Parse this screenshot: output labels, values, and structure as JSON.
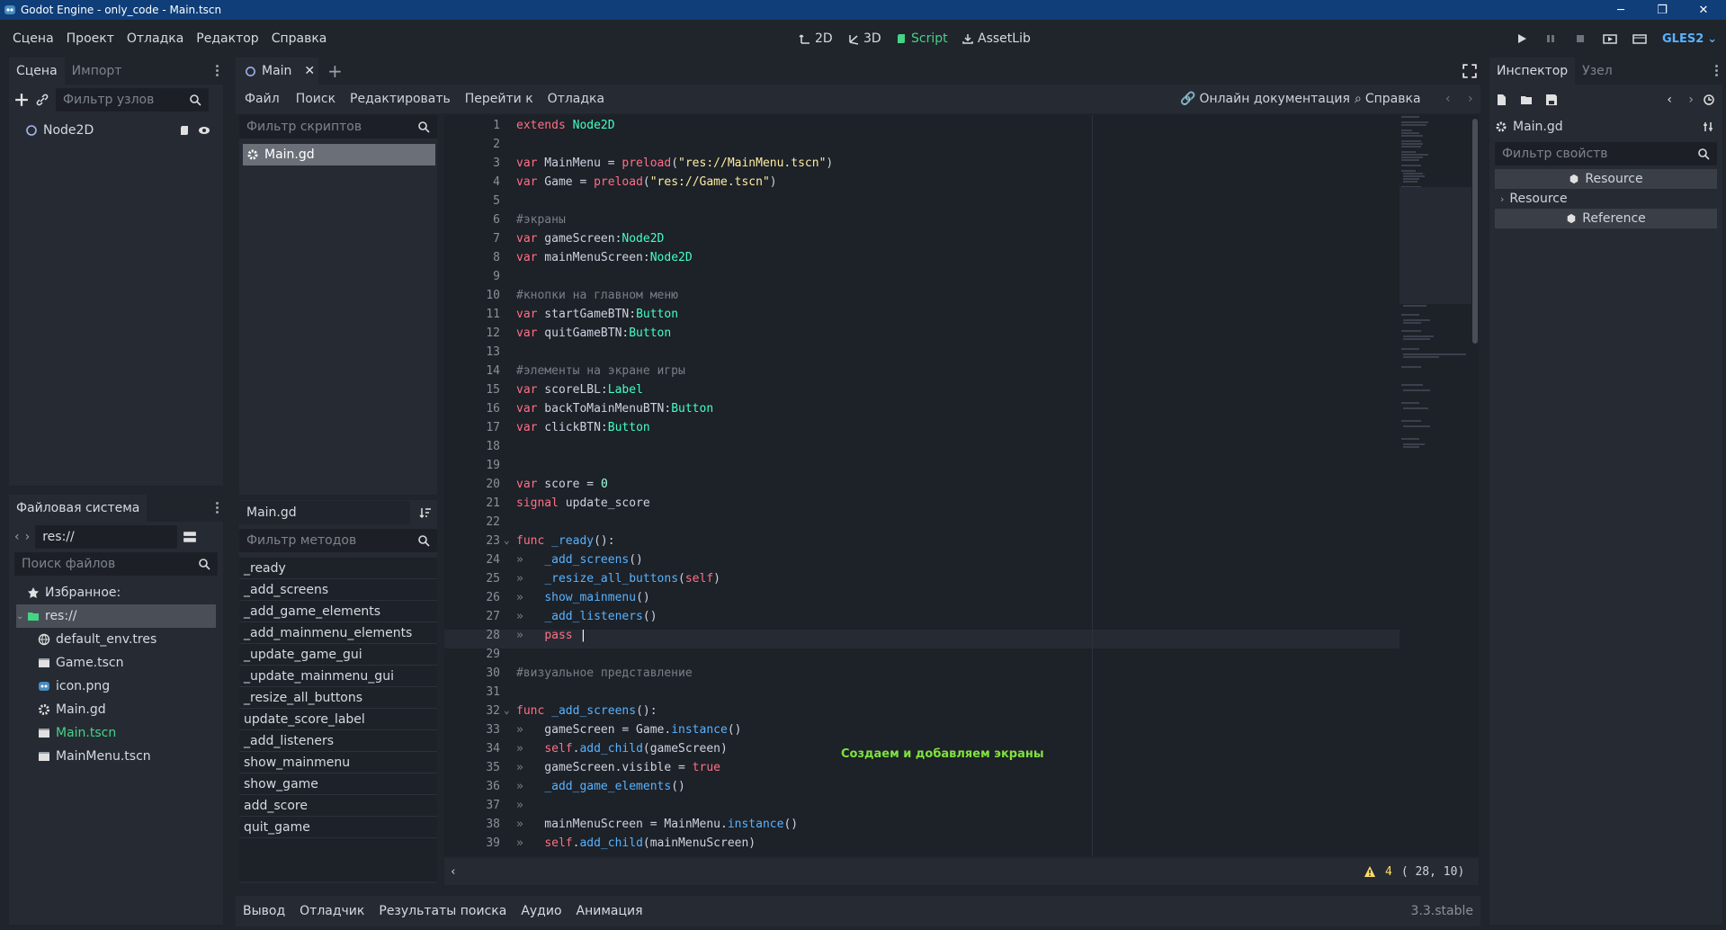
{
  "window": {
    "title": "Godot Engine - only_code - Main.tscn"
  },
  "menu": [
    "Сцена",
    "Проект",
    "Отладка",
    "Редактор",
    "Справка"
  ],
  "workspaces": {
    "w2d": "2D",
    "w3d": "3D",
    "script": "Script",
    "assetlib": "AssetLib"
  },
  "renderer": "GLES2",
  "scene_dock": {
    "tab_scene": "Сцена",
    "tab_import": "Импорт",
    "filter_placeholder": "Фильтр узлов",
    "root_node": "Node2D"
  },
  "fs_dock": {
    "title": "Файловая система",
    "path": "res://",
    "search_placeholder": "Поиск файлов",
    "favorites": "Избранное:",
    "root": "res://",
    "files": [
      "default_env.tres",
      "Game.tscn",
      "icon.png",
      "Main.gd",
      "Main.tscn",
      "MainMenu.tscn"
    ]
  },
  "script_editor": {
    "tab": "Main",
    "menu": {
      "file": "Файл",
      "search": "Поиск",
      "edit": "Редактировать",
      "goto": "Перейти к",
      "debug": "Отладка"
    },
    "online_docs": "Онлайн документация",
    "help": "Справка",
    "script_filter_placeholder": "Фильтр скриптов",
    "scripts": [
      "Main.gd"
    ],
    "current_script": "Main.gd",
    "method_filter_placeholder": "Фильтр методов",
    "methods": [
      "_ready",
      "_add_screens",
      "_add_game_elements",
      "_add_mainmenu_elements",
      "_update_game_gui",
      "_update_mainmenu_gui",
      "_resize_all_buttons",
      "update_score_label",
      "_add_listeners",
      "show_mainmenu",
      "show_game",
      "add_score",
      "quit_game"
    ],
    "annotation": "Создаем и добавляем экраны",
    "warnings": "4",
    "cursor": "( 28, 10)"
  },
  "code_lines": [
    {
      "n": "1",
      "h": "<span class='kw'>extends</span> <span class='ty'>Node2D</span>"
    },
    {
      "n": "2",
      "h": ""
    },
    {
      "n": "3",
      "h": "<span class='kw'>var</span> MainMenu = <span class='kw'>preload</span>(<span class='st'>\"res://MainMenu.tscn\"</span>)"
    },
    {
      "n": "4",
      "h": "<span class='kw'>var</span> Game = <span class='kw'>preload</span>(<span class='st'>\"res://Game.tscn\"</span>)"
    },
    {
      "n": "5",
      "h": ""
    },
    {
      "n": "6",
      "h": "<span class='cm'>#экраны</span>"
    },
    {
      "n": "7",
      "h": "<span class='kw'>var</span> gameScreen:<span class='ty'>Node2D</span>"
    },
    {
      "n": "8",
      "h": "<span class='kw'>var</span> mainMenuScreen:<span class='ty'>Node2D</span>"
    },
    {
      "n": "9",
      "h": ""
    },
    {
      "n": "10",
      "h": "<span class='cm'>#кнопки на главном меню</span>"
    },
    {
      "n": "11",
      "h": "<span class='kw'>var</span> startGameBTN:<span class='ty'>Button</span>"
    },
    {
      "n": "12",
      "h": "<span class='kw'>var</span> quitGameBTN:<span class='ty'>Button</span>"
    },
    {
      "n": "13",
      "h": ""
    },
    {
      "n": "14",
      "h": "<span class='cm'>#элементы на экране игры</span>"
    },
    {
      "n": "15",
      "h": "<span class='kw'>var</span> scoreLBL:<span class='ty'>Label</span>"
    },
    {
      "n": "16",
      "h": "<span class='kw'>var</span> backToMainMenuBTN:<span class='ty'>Button</span>"
    },
    {
      "n": "17",
      "h": "<span class='kw'>var</span> clickBTN:<span class='ty'>Button</span>"
    },
    {
      "n": "18",
      "h": ""
    },
    {
      "n": "19",
      "h": ""
    },
    {
      "n": "20",
      "h": "<span class='kw'>var</span> score = <span class='nu'>0</span>"
    },
    {
      "n": "21",
      "h": "<span class='kw'>signal</span> update_score"
    },
    {
      "n": "22",
      "h": ""
    },
    {
      "n": "23",
      "h": "<span class='kw'>func</span> <span class='fn'>_ready</span>():"
    },
    {
      "n": "24",
      "h": "<span class='cm'>»</span>   <span class='fn'>_add_screens</span>()"
    },
    {
      "n": "25",
      "h": "<span class='cm'>»</span>   <span class='fn'>_resize_all_buttons</span>(<span class='kw'>self</span>)"
    },
    {
      "n": "26",
      "h": "<span class='cm'>»</span>   <span class='fn'>show_mainmenu</span>()"
    },
    {
      "n": "27",
      "h": "<span class='cm'>»</span>   <span class='fn'>_add_listeners</span>()"
    },
    {
      "n": "28",
      "h": "<span class='cm'>»</span>   <span class='kw'>pass</span> <span style='color:#fff'>|</span>"
    },
    {
      "n": "29",
      "h": ""
    },
    {
      "n": "30",
      "h": "<span class='cm'>#визуальное представление</span>"
    },
    {
      "n": "31",
      "h": ""
    },
    {
      "n": "32",
      "h": "<span class='kw'>func</span> <span class='fn'>_add_screens</span>():"
    },
    {
      "n": "33",
      "h": "<span class='cm'>»</span>   gameScreen = Game.<span class='fn'>instance</span>()"
    },
    {
      "n": "34",
      "h": "<span class='cm'>»</span>   <span class='kw'>self</span>.<span class='fn'>add_child</span>(gameScreen)"
    },
    {
      "n": "35",
      "h": "<span class='cm'>»</span>   gameScreen.visible = <span class='kw'>true</span>"
    },
    {
      "n": "36",
      "h": "<span class='cm'>»</span>   <span class='fn'>_add_game_elements</span>()"
    },
    {
      "n": "37",
      "h": "<span class='cm'>»</span>"
    },
    {
      "n": "38",
      "h": "<span class='cm'>»</span>   mainMenuScreen = MainMenu.<span class='fn'>instance</span>()"
    },
    {
      "n": "39",
      "h": "<span class='cm'>»</span>   <span class='kw'>self</span>.<span class='fn'>add_child</span>(mainMenuScreen)"
    }
  ],
  "inspector": {
    "tab_inspector": "Инспектор",
    "tab_node": "Узел",
    "resource_name": "Main.gd",
    "filter_placeholder": "Фильтр свойств",
    "section1": "Resource",
    "section2": "Resource",
    "section3": "Reference"
  },
  "bottom": {
    "output": "Вывод",
    "debugger": "Отладчик",
    "search_results": "Результаты поиска",
    "audio": "Аудио",
    "animation": "Анимация",
    "version": "3.3.stable"
  }
}
